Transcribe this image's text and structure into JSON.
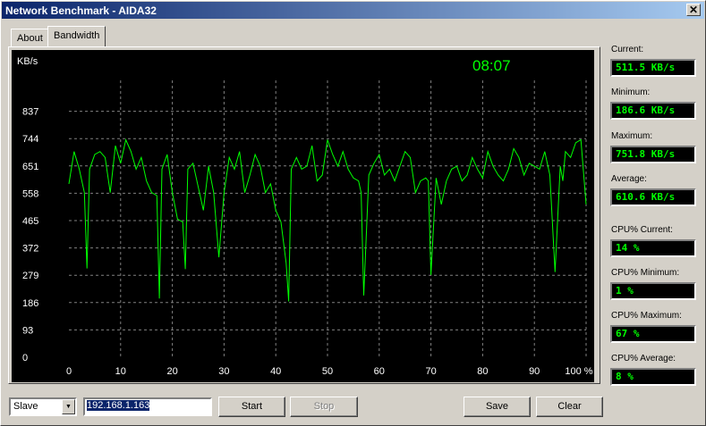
{
  "window": {
    "title": "Network Benchmark - AIDA32",
    "close_glyph": "✕"
  },
  "tabs": [
    {
      "label": "About",
      "active": false
    },
    {
      "label": "Bandwidth",
      "active": true
    }
  ],
  "chart_data": {
    "type": "line",
    "ylabel": "KB/s",
    "timer": "08:07",
    "y_ticks": [
      "0",
      "93",
      "186",
      "279",
      "372",
      "465",
      "558",
      "651",
      "744",
      "837"
    ],
    "x_ticks": [
      "0",
      "10",
      "20",
      "30",
      "40",
      "50",
      "60",
      "70",
      "80",
      "90",
      "100 %"
    ],
    "xlim": [
      0,
      100
    ],
    "ylim": [
      0,
      930
    ],
    "grid": true,
    "line_color": "#00ff00",
    "series": [
      {
        "x": [
          0,
          1,
          2,
          3,
          3.5,
          4,
          5,
          6,
          7,
          8,
          9,
          10,
          11,
          12,
          13,
          14,
          15,
          16,
          17,
          17.5,
          18,
          19,
          20,
          21,
          22,
          22.5,
          23,
          24,
          25,
          26,
          27,
          28,
          29,
          30,
          31,
          32,
          33,
          34,
          35,
          36,
          37,
          38,
          39,
          40,
          41,
          42,
          42.5,
          43,
          44,
          45,
          46,
          47,
          48,
          49,
          50,
          51,
          52,
          53,
          54,
          55,
          56,
          56.5,
          57,
          58,
          59,
          60,
          61,
          62,
          63,
          64,
          65,
          66,
          67,
          68,
          69,
          69.5,
          70,
          71,
          72,
          73,
          74,
          75,
          76,
          77,
          78,
          79,
          80,
          81,
          82,
          83,
          84,
          85,
          86,
          87,
          88,
          89,
          90,
          91,
          92,
          93,
          94,
          95,
          95.5,
          96,
          97,
          98,
          99,
          100
        ],
        "y": [
          590,
          700,
          640,
          560,
          302,
          640,
          690,
          700,
          680,
          560,
          720,
          660,
          740,
          700,
          640,
          680,
          600,
          560,
          550,
          200,
          640,
          690,
          560,
          470,
          460,
          300,
          640,
          660,
          580,
          500,
          650,
          560,
          340,
          560,
          680,
          640,
          700,
          560,
          620,
          690,
          650,
          560,
          590,
          500,
          460,
          320,
          190,
          640,
          680,
          640,
          650,
          720,
          600,
          620,
          740,
          690,
          650,
          700,
          640,
          610,
          600,
          560,
          210,
          620,
          660,
          690,
          620,
          640,
          600,
          650,
          700,
          680,
          560,
          600,
          610,
          600,
          280,
          610,
          520,
          600,
          640,
          650,
          600,
          620,
          680,
          640,
          610,
          700,
          650,
          620,
          600,
          640,
          710,
          680,
          620,
          660,
          650,
          640,
          700,
          620,
          290,
          650,
          600,
          700,
          680,
          730,
          740,
          520
        ]
      }
    ]
  },
  "stats": [
    {
      "label": "Current:",
      "value": "511.5 KB/s"
    },
    {
      "label": "Minimum:",
      "value": "186.6 KB/s"
    },
    {
      "label": "Maximum:",
      "value": "751.8 KB/s"
    },
    {
      "label": "Average:",
      "value": "610.6 KB/s"
    },
    {
      "label": "CPU% Current:",
      "value": "14 %"
    },
    {
      "label": "CPU% Minimum:",
      "value": "1 %"
    },
    {
      "label": "CPU% Maximum:",
      "value": "67 %"
    },
    {
      "label": "CPU% Average:",
      "value": "8 %"
    }
  ],
  "controls": {
    "mode_select": {
      "value": "Slave"
    },
    "ip_input": {
      "value": "192.168.1.163"
    },
    "start_label": "Start",
    "stop_label": "Stop",
    "save_label": "Save",
    "clear_label": "Clear"
  }
}
